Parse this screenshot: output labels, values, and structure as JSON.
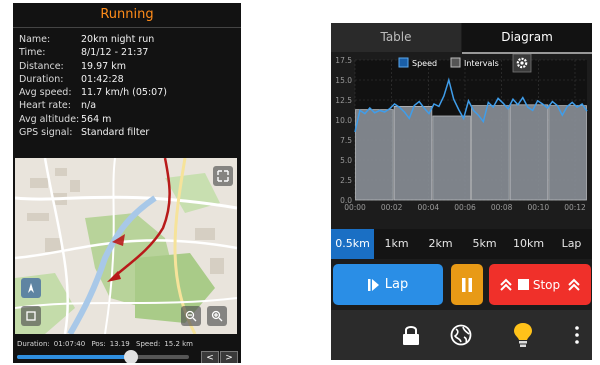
{
  "left": {
    "title": "Running",
    "fields": [
      {
        "label": "Name:",
        "value": "20km night run"
      },
      {
        "label": "Time:",
        "value": "8/1/12 - 21:37"
      },
      {
        "label": "Distance:",
        "value": "19.97 km"
      },
      {
        "label": "Duration:",
        "value": "01:42:28"
      },
      {
        "label": "Avg speed:",
        "value": "11.7 km/h (05:07)"
      },
      {
        "label": "Heart rate:",
        "value": "n/a"
      },
      {
        "label": "Avg altitude:",
        "value": "564 m"
      },
      {
        "label": "GPS signal:",
        "value": "Standard filter"
      }
    ],
    "map": {
      "icons": [
        "expand-icon",
        "compass-icon",
        "fullscreen-icon",
        "zoom-out-icon",
        "zoom-in-icon"
      ]
    },
    "playback": {
      "duration_label": "Duration:",
      "duration_value": "01:07:40",
      "pos_label": "Pos:",
      "pos_value": "13.19",
      "speed_label": "Speed:",
      "speed_value": "15.2 km",
      "progress": 0.66,
      "prev": "<",
      "next": ">"
    }
  },
  "right": {
    "tabs": [
      {
        "label": "Table",
        "active": false
      },
      {
        "label": "Diagram",
        "active": true
      }
    ],
    "legend": {
      "speed": "Speed",
      "intervals": "Intervals"
    },
    "chart_data": {
      "type": "area",
      "x_labels": [
        "00:00",
        "00:02",
        "00:04",
        "00:06",
        "00:08",
        "00:10",
        "00:12"
      ],
      "y_ticks": [
        "0.0",
        "2.5",
        "5.0",
        "7.5",
        "10.0",
        "12.5",
        "15.0",
        "17.5"
      ],
      "ylim": [
        0,
        17.5
      ],
      "series": [
        {
          "name": "Speed",
          "type": "line",
          "color": "#3f9dea",
          "values": [
            8.5,
            11.2,
            10.8,
            11.5,
            10.9,
            11.2,
            11.0,
            11.4,
            12.0,
            11.6,
            11.0,
            10.2,
            11.8,
            12.3,
            11.5,
            10.8,
            12.0,
            11.7,
            13.0,
            15.0,
            12.6,
            11.3,
            10.2,
            12.4,
            11.2,
            10.6,
            9.8,
            12.2,
            11.6,
            12.7,
            12.1,
            11.4,
            12.6,
            11.9,
            12.8,
            11.6,
            11.2,
            12.4,
            12.0,
            11.5,
            12.3,
            11.8,
            10.6,
            11.7,
            12.2,
            11.6,
            12.0,
            11.1
          ]
        },
        {
          "name": "Intervals",
          "type": "bar",
          "color": "#8f959d",
          "values": [
            11.3,
            11.7,
            10.5,
            11.8,
            11.9,
            11.8
          ]
        }
      ],
      "grid": true
    },
    "distances": [
      {
        "label": "0.5km",
        "selected": true
      },
      {
        "label": "1km",
        "selected": false
      },
      {
        "label": "2km",
        "selected": false
      },
      {
        "label": "5km",
        "selected": false
      },
      {
        "label": "10km",
        "selected": false
      },
      {
        "label": "Lap",
        "selected": false
      }
    ],
    "controls": {
      "lap": "Lap",
      "stop": "Stop"
    },
    "actionbar": {
      "icons": [
        "lock-icon",
        "globe-icon",
        "lightbulb-icon",
        "overflow-menu-icon"
      ]
    },
    "colors": {
      "accent": "#2a8ee6",
      "pause": "#e89a16",
      "stop": "#f0302a",
      "title": "#ff8c1a"
    }
  }
}
